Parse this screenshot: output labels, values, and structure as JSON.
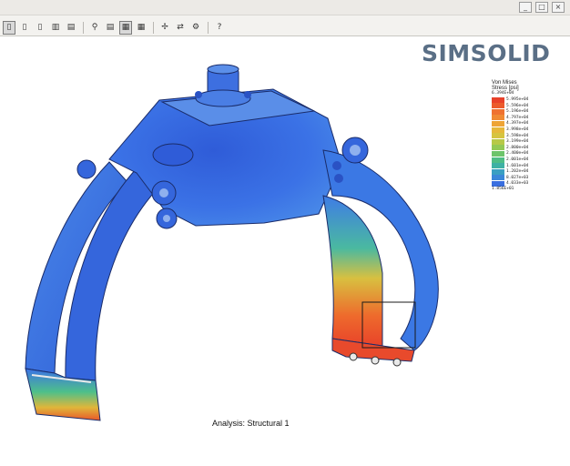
{
  "window": {
    "controls": [
      "_",
      "□",
      "×"
    ]
  },
  "toolbar": {
    "buttons": [
      "▯",
      "▯",
      "▯",
      "▥",
      "▤",
      "⚲",
      "▤",
      "▦",
      "▦",
      "✢",
      "⇄",
      "⚙",
      "?"
    ]
  },
  "logo": {
    "text": "SIMSOLID"
  },
  "legend": {
    "title_line1": "Von Mises",
    "title_line2": "Stress [psi]",
    "max": "6.394E+04",
    "min": "1.856E+01",
    "entries": [
      {
        "label": "5.995e+04",
        "color": "#e8412a"
      },
      {
        "label": "5.596e+04",
        "color": "#ec5a2c"
      },
      {
        "label": "5.196e+04",
        "color": "#ef7230"
      },
      {
        "label": "4.797e+04",
        "color": "#f08a33"
      },
      {
        "label": "4.397e+04",
        "color": "#eea436"
      },
      {
        "label": "3.998e+04",
        "color": "#e6b83b"
      },
      {
        "label": "3.598e+04",
        "color": "#d6c440"
      },
      {
        "label": "3.199e+04",
        "color": "#b7c947"
      },
      {
        "label": "2.800e+04",
        "color": "#93c955"
      },
      {
        "label": "2.400e+04",
        "color": "#6dc46a"
      },
      {
        "label": "2.001e+04",
        "color": "#4fbd85"
      },
      {
        "label": "1.601e+04",
        "color": "#3eb1a4"
      },
      {
        "label": "1.202e+04",
        "color": "#3a9fc2"
      },
      {
        "label": "8.027e+03",
        "color": "#3b87d8"
      },
      {
        "label": "4.033e+03",
        "color": "#3a6fe0"
      }
    ]
  },
  "analysis": {
    "label": "Analysis: Structural  1"
  },
  "colors": {
    "part_blue": "#3d6fe6",
    "part_dark": "#2a52c4",
    "stress_red": "#e8432a"
  }
}
